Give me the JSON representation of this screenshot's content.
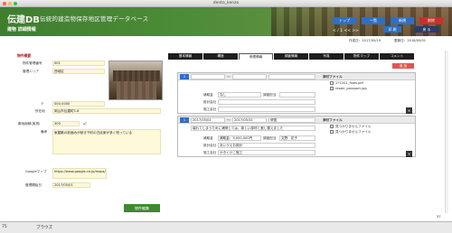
{
  "window": {
    "title": "dento_kenzo"
  },
  "header": {
    "app_name": "伝建DB",
    "app_subtitle": "伝統的建造物保存地区管理データベース",
    "screen_title": "建物  詳細情報",
    "buttons": {
      "top": "トップ",
      "list": "一覧",
      "new": "新規",
      "delete": "削除"
    },
    "pager": "< / 1 <<  >>",
    "print_button": "印 刷",
    "return_button": "戻 る"
  },
  "meta": {
    "created": "作成日：2017/05/19",
    "updated": "更新日：2018/05/01"
  },
  "left": {
    "section_title": "物件概要",
    "property_number_label": "物件管理番号",
    "property_number_value": "001",
    "area_label": "管理エリア",
    "area_value": "西地区",
    "postal_label": "〒",
    "postal_value": "000-0000",
    "address_label": "所在地",
    "address_value": "岡山市伝建町5-6",
    "class_label": "敷地面積(実測)",
    "class_value": "300",
    "class_unit": "㎡",
    "remarks_label": "備考",
    "remarks_value": "家屋敷の前面みが続き下町の古民家が多く残っている",
    "map_label": "Googleマップ",
    "map_value": "https://www.google.co.jp/maps/@34.6669406,133.9363982,17z",
    "start_label": "管理開始日",
    "start_value": "2017/05/01",
    "edit_button": "物件編集"
  },
  "tabs": [
    "基本情報",
    "構造",
    "修理情報",
    "調査情報",
    "写真",
    "物件マップ",
    "コメント"
  ],
  "active_tab": 2,
  "add_button": "追 加",
  "records": [
    {
      "number": "2",
      "date_from": "",
      "date_to": "",
      "category": "",
      "subsidy_label": "補助金",
      "subsidy_value": "なし",
      "surveyor_label": "調査担当",
      "surveyor_value": "",
      "designer_label": "設計会社",
      "designer_value": "",
      "contractor_label": "施工会社",
      "contractor_value": "",
      "attach_title": "添付ファイル",
      "attachments": [
        "171201_fixes.pdf",
        "repair_passport.jpg"
      ]
    },
    {
      "number": "1",
      "date_from": "2017/05/01",
      "date_to": "2017/05/31",
      "category": "修復",
      "description": "壊れてしまうために補修しては、新しい部材と差し替えました",
      "subsidy_label": "補助金",
      "subsidy_value": "補助金：3,000,000円",
      "surveyor_label": "調査担当",
      "surveyor_value": "文野　花子",
      "designer_label": "設計会社",
      "designer_value": "あいうえお設計",
      "contractor_label": "施工会社",
      "contractor_value": "かきくけこ施工",
      "attach_title": "添付ファイル",
      "attachments": [
        "見つかりませんファイル",
        "見つかりませんファイル"
      ]
    }
  ],
  "page_number": "37",
  "status": {
    "zoom": "75",
    "mode": "ブラウズ"
  }
}
